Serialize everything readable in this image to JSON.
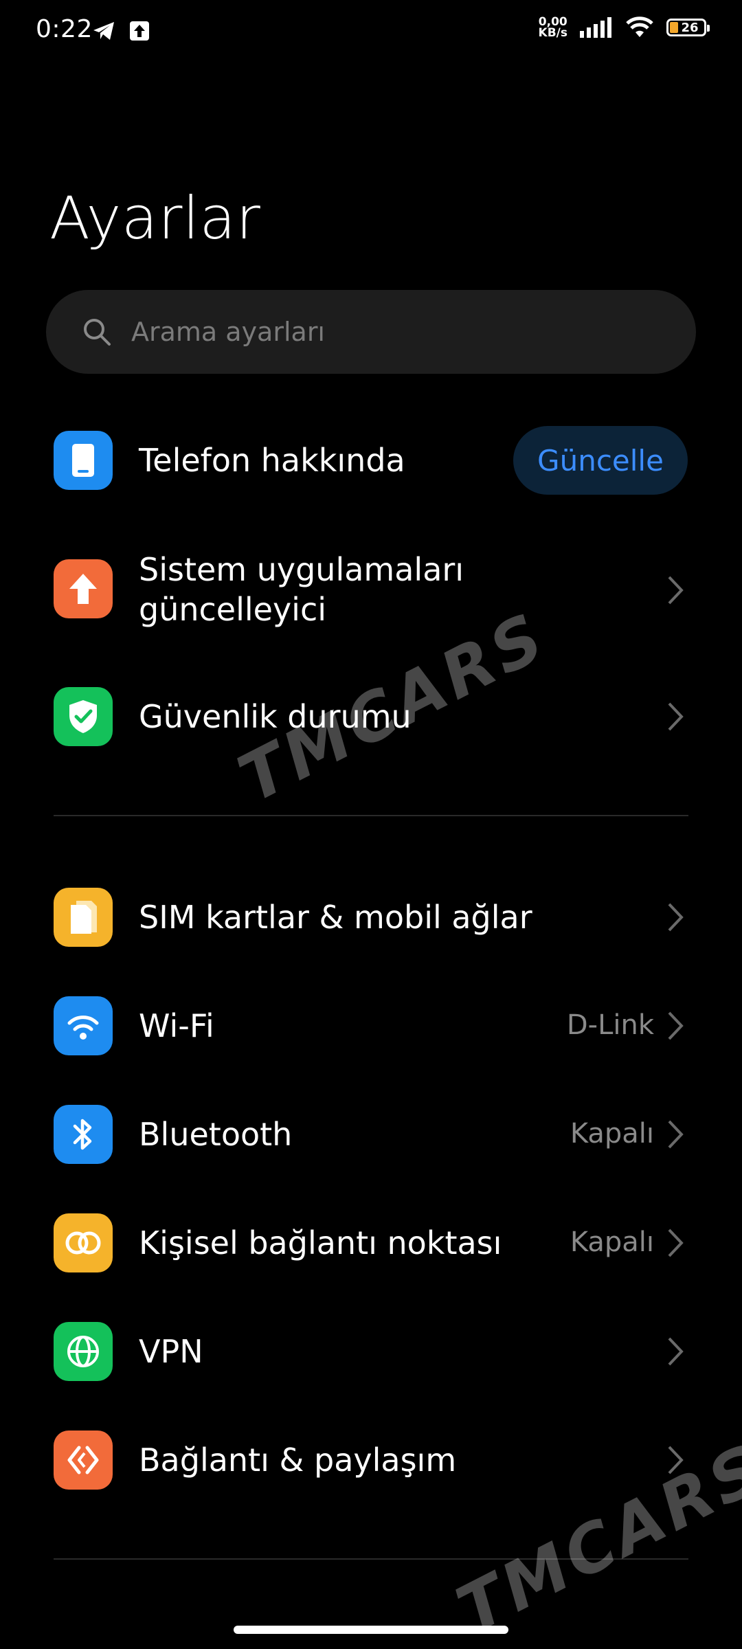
{
  "status_bar": {
    "time": "0:22",
    "net_speed_value": "0,00",
    "net_speed_unit": "KB/s",
    "battery_level": "26"
  },
  "page": {
    "title": "Ayarlar"
  },
  "search": {
    "placeholder": "Arama ayarları"
  },
  "items": [
    {
      "label": "Telefon hakkında",
      "button": "Güncelle",
      "icon": "phone-icon",
      "color": "#1e8cf0"
    },
    {
      "label": "Sistem uygulamaları güncelleyici",
      "icon": "upload-arrow-icon",
      "color": "#f26b3a"
    },
    {
      "label": "Güvenlik durumu",
      "icon": "shield-check-icon",
      "color": "#14c15a"
    },
    {
      "label": "SIM kartlar & mobil ağlar",
      "icon": "sim-card-icon",
      "color": "#f5b32b"
    },
    {
      "label": "Wi-Fi",
      "value": "D-Link",
      "icon": "wifi-icon",
      "color": "#1e8cf0"
    },
    {
      "label": "Bluetooth",
      "value": "Kapalı",
      "icon": "bluetooth-icon",
      "color": "#1e8cf0"
    },
    {
      "label": "Kişisel bağlantı noktası",
      "value": "Kapalı",
      "icon": "hotspot-icon",
      "color": "#f5b32b"
    },
    {
      "label": "VPN",
      "icon": "globe-icon",
      "color": "#14c15a"
    },
    {
      "label": "Bağlantı & paylaşım",
      "icon": "share-icon",
      "color": "#f26b3a"
    }
  ],
  "watermark": {
    "text": "TMCARS"
  }
}
